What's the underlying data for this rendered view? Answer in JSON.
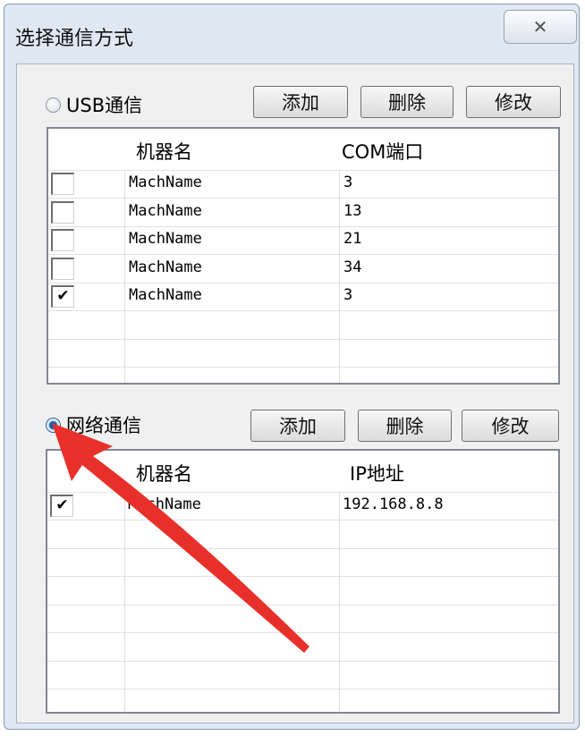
{
  "dialog": {
    "title": "选择通信方式",
    "close_glyph": "✕"
  },
  "usb": {
    "label": "USB通信",
    "selected": false,
    "buttons": {
      "add": "添加",
      "delete": "删除",
      "modify": "修改"
    },
    "columns": [
      "机器名",
      "COM端口"
    ],
    "rows": [
      {
        "checked": false,
        "name": "MachName",
        "port": "3"
      },
      {
        "checked": false,
        "name": "MachName",
        "port": "13"
      },
      {
        "checked": false,
        "name": "MachName",
        "port": "21"
      },
      {
        "checked": false,
        "name": "MachName",
        "port": "34"
      },
      {
        "checked": true,
        "name": "MachName",
        "port": "3"
      }
    ]
  },
  "network": {
    "label": "网络通信",
    "selected": true,
    "buttons": {
      "add": "添加",
      "delete": "删除",
      "modify": "修改"
    },
    "columns": [
      "机器名",
      "IP地址"
    ],
    "rows": [
      {
        "checked": true,
        "name": "MachName",
        "ip": "192.168.8.8"
      }
    ]
  },
  "annotation": {
    "arrow_color": "#e8302a"
  }
}
